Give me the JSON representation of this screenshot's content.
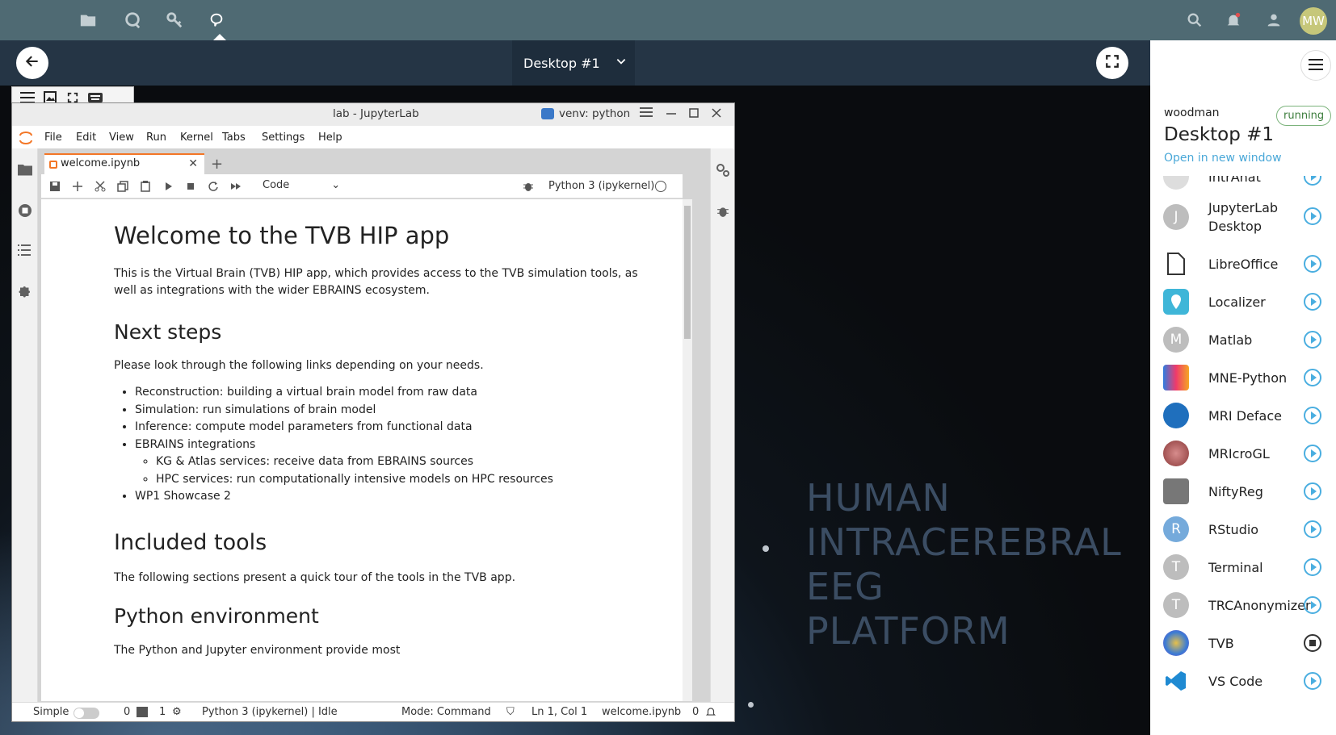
{
  "topbar": {
    "avatar": "MW",
    "icons": [
      "folder-icon",
      "chat-icon",
      "key-icon",
      "brain-icon",
      "search-icon",
      "bell-icon",
      "users-icon"
    ]
  },
  "subbar": {
    "desktop_select": "Desktop #1"
  },
  "brand": {
    "line1": "HUMAN",
    "line2": "INTRACEREBRAL",
    "line3": "EEG",
    "line4": "PLATFORM"
  },
  "window": {
    "title": "lab - JupyterLab",
    "venv": "venv: python",
    "menu": [
      "File",
      "Edit",
      "View",
      "Run",
      "Kernel",
      "Tabs",
      "Settings",
      "Help"
    ],
    "tab": "welcome.ipynb",
    "cell_type": "Code",
    "kernel": "Python 3 (ipykernel)"
  },
  "notebook": {
    "h1": "Welcome to the TVB HIP app",
    "intro": "This is the Virtual Brain (TVB) HIP app, which provides access to the TVB simulation tools, as well as integrations with the wider EBRAINS ecosystem.",
    "h2_next": "Next steps",
    "next_p": "Please look through the following links depending on your needs.",
    "items": {
      "i1": "Reconstruction: building a virtual brain model from raw data",
      "i2": "Simulation: run simulations of brain model",
      "i3": "Inference: compute model parameters from functional data",
      "i4": "EBRAINS integrations",
      "i4a": "KG & Atlas services: receive data from EBRAINS sources",
      "i4b": "HPC services: run computationally intensive models on HPC resources",
      "i5": "WP1 Showcase 2"
    },
    "h2_tools": "Included tools",
    "tools_p": "The following sections present a quick tour of the tools in the TVB app.",
    "h2_py": "Python environment",
    "py_p": "The Python and Jupyter environment provide most"
  },
  "status": {
    "mode_label": "Simple",
    "n0": "0",
    "n1": "1",
    "kernel": "Python 3 (ipykernel) | Idle",
    "mode": "Mode: Command",
    "pos": "Ln 1, Col 1",
    "file": "welcome.ipynb",
    "count": "0"
  },
  "panel": {
    "user": "woodman",
    "status": "running",
    "title": "Desktop #1",
    "open_link": "Open in new window",
    "apps": [
      {
        "name": "IntrAnat",
        "letter": ""
      },
      {
        "name": "JupyterLab Desktop",
        "letter": "J"
      },
      {
        "name": "LibreOffice",
        "letter": ""
      },
      {
        "name": "Localizer",
        "letter": ""
      },
      {
        "name": "Matlab",
        "letter": "M"
      },
      {
        "name": "MNE-Python",
        "letter": ""
      },
      {
        "name": "MRI Deface",
        "letter": ""
      },
      {
        "name": "MRIcroGL",
        "letter": ""
      },
      {
        "name": "NiftyReg",
        "letter": ""
      },
      {
        "name": "RStudio",
        "letter": "R"
      },
      {
        "name": "Terminal",
        "letter": "T"
      },
      {
        "name": "TRCAnonymizer",
        "letter": "T"
      },
      {
        "name": "TVB",
        "letter": ""
      },
      {
        "name": "VS Code",
        "letter": ""
      }
    ]
  },
  "colors": {
    "topbar": "#4f6a73",
    "subbar": "#253545",
    "accent": "#4aaee0",
    "jupyter_orange": "#f37626"
  }
}
